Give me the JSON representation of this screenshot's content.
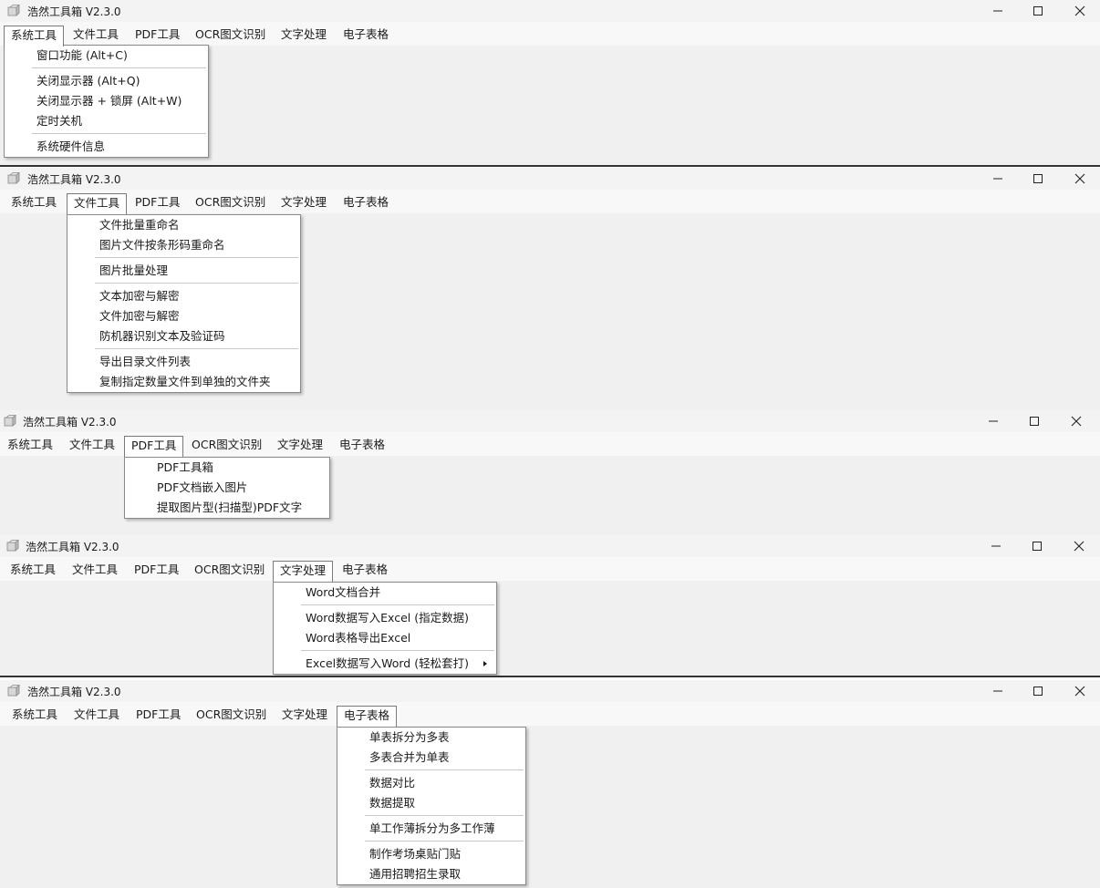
{
  "app": {
    "title": "浩然工具箱 V2.3.0"
  },
  "menubar": {
    "items": [
      "系统工具",
      "文件工具",
      "PDF工具",
      "OCR图文识别",
      "文字处理",
      "电子表格"
    ]
  },
  "menus": {
    "system_tools": {
      "items": [
        "窗口功能 (Alt+C)",
        "关闭显示器 (Alt+Q)",
        "关闭显示器 + 锁屏 (Alt+W)",
        "定时关机",
        "系统硬件信息"
      ]
    },
    "file_tools": {
      "items": [
        "文件批量重命名",
        "图片文件按条形码重命名",
        "图片批量处理",
        "文本加密与解密",
        "文件加密与解密",
        "防机器识别文本及验证码",
        "导出目录文件列表",
        "复制指定数量文件到单独的文件夹"
      ]
    },
    "pdf_tools": {
      "items": [
        "PDF工具箱",
        "PDF文档嵌入图片",
        "提取图片型(扫描型)PDF文字"
      ]
    },
    "text_processing": {
      "items": [
        "Word文档合并",
        "Word数据写入Excel (指定数据)",
        "Word表格导出Excel",
        "Excel数据写入Word (轻松套打)"
      ]
    },
    "spreadsheet": {
      "items": [
        "单表拆分为多表",
        "多表合并为单表",
        "数据对比",
        "数据提取",
        "单工作薄拆分为多工作薄",
        "制作考场桌贴门贴",
        "通用招聘招生录取"
      ]
    }
  },
  "icons": {
    "app": "toolbox-icon",
    "minimize": "minimize-icon",
    "maximize": "maximize-icon",
    "close": "close-icon",
    "submenu": "chevron-right-icon"
  },
  "colors": {
    "window_bg": "#f0f0f0",
    "menu_bg": "#ffffff",
    "menu_border": "#8a8a8a",
    "separator": "#c8c8c8"
  }
}
